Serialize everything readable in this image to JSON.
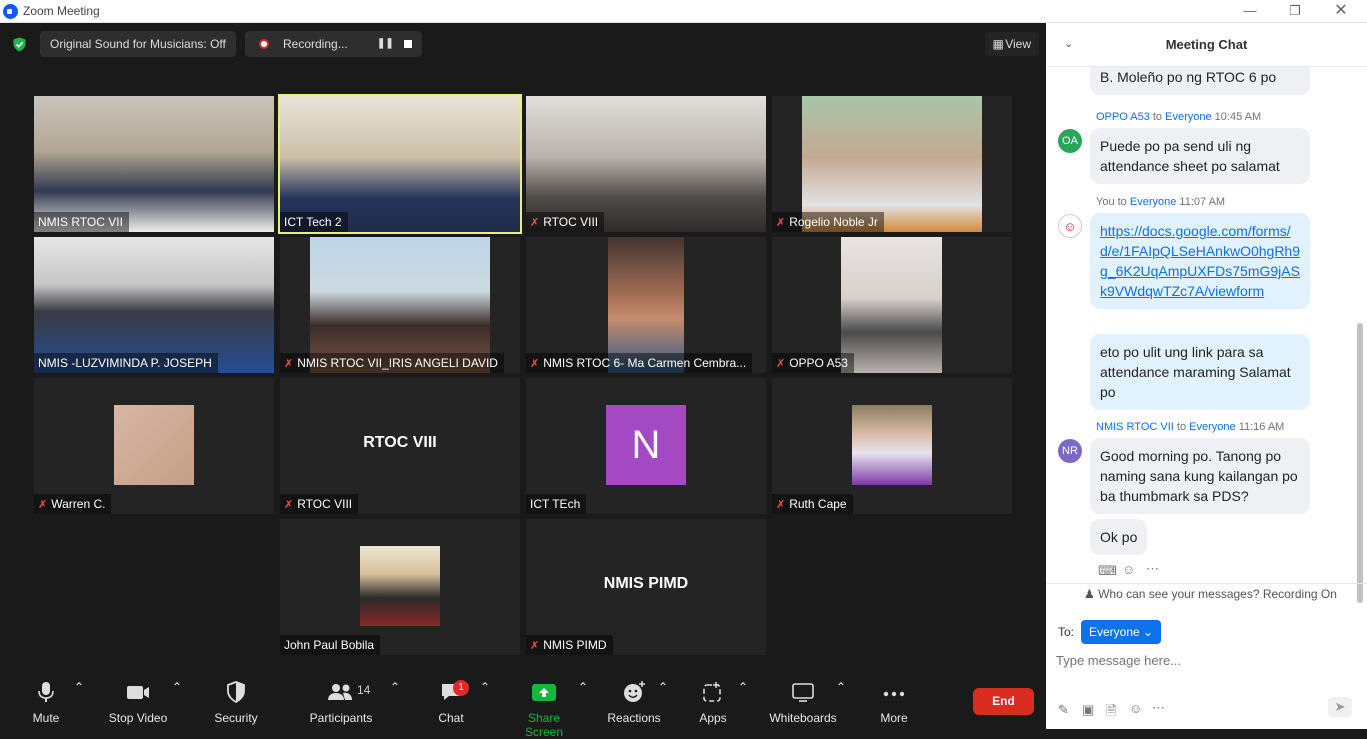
{
  "window": {
    "title": "Zoom Meeting"
  },
  "top_bar": {
    "original_sound": "Original Sound for Musicians: Off",
    "recording": "Recording...",
    "view": "View"
  },
  "tiles": [
    {
      "name": "NMIS RTOC VII",
      "muted": false
    },
    {
      "name": "ICT Tech 2",
      "muted": false
    },
    {
      "name": "RTOC VIII",
      "muted": true
    },
    {
      "name": "Rogelio Noble Jr",
      "muted": true
    },
    {
      "name": "NMIS -LUZVIMINDA P. JOSEPH",
      "muted": false
    },
    {
      "name": "NMIS RTOC VII_IRIS ANGELI DAVID",
      "muted": true
    },
    {
      "name": "NMIS RTOC 6- Ma Carmen Cembra...",
      "muted": true
    },
    {
      "name": "OPPO A53",
      "muted": true
    },
    {
      "name": "Warren C.",
      "muted": true
    },
    {
      "name": "RTOC VIII",
      "muted": true,
      "center": "RTOC VIII"
    },
    {
      "name": "ICT TEch",
      "muted": false,
      "initial": "N"
    },
    {
      "name": "Ruth Cape",
      "muted": true
    },
    {
      "name": "John Paul Bobila",
      "muted": false
    },
    {
      "name": "NMIS PIMD",
      "muted": true,
      "center": "NMIS PIMD"
    }
  ],
  "toolbar": {
    "mute": "Mute",
    "stop_video": "Stop Video",
    "security": "Security",
    "participants": "Participants",
    "participants_count": "14",
    "chat": "Chat",
    "chat_badge": "1",
    "share": "Share Screen",
    "reactions": "Reactions",
    "apps": "Apps",
    "whiteboards": "Whiteboards",
    "more": "More",
    "end": "End"
  },
  "chat": {
    "title": "Meeting Chat",
    "partial_msg": "B. Moleño po ng RTOC 6 po",
    "m1_sender": "OPPO A53",
    "m1_to": "to",
    "m1_recipient": "Everyone",
    "m1_time": "10:45 AM",
    "m1_initials": "OA",
    "m1_text": "Puede po pa send uli ng attendance sheet po salamat",
    "m2_sender": "You",
    "m2_to": "to",
    "m2_recipient": "Everyone",
    "m2_time": "11:07 AM",
    "m2_link": "https://docs.google.com/forms/d/e/1FAIpQLSeHAnkwO0hgRh9g_6K2UqAmpUXFDs75mG9jASk9VWdqwTZc7A/viewform",
    "m2_text": "eto po ulit ung link para sa attendance maraming Salamat po",
    "m3_sender": "NMIS RTOC VII",
    "m3_to": "to",
    "m3_recipient": "Everyone",
    "m3_time": "11:16 AM",
    "m3_initials": "NR",
    "m3_text": "Good morning po. Tanong po naming sana kung kailangan po ba thumbmark sa PDS?",
    "m3_text2": "Ok po",
    "who_can_see": "Who can see your messages? Recording On",
    "to_label": "To:",
    "to_value": "Everyone",
    "placeholder": "Type message here..."
  },
  "colors": {
    "accent": "#0e72ed",
    "end": "#d92d20",
    "share": "#12b83b",
    "selected": "#e7f17a",
    "avatar_oa": "#2aa65a",
    "avatar_nr": "#7b68c8"
  }
}
